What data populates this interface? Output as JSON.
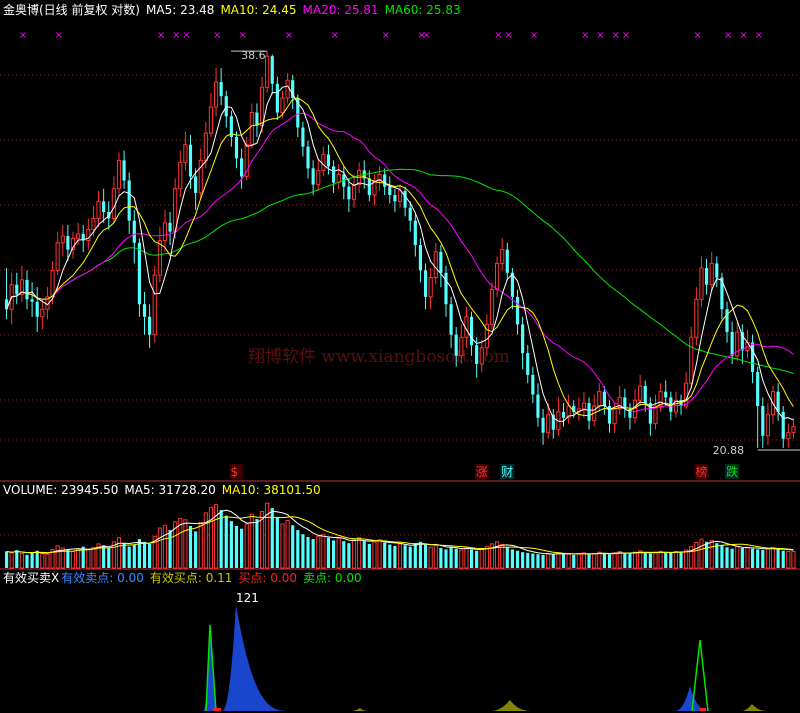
{
  "colors": {
    "bg": "#000000",
    "up": "#ff3232",
    "down": "#54ffff",
    "ma5": "#ffffff",
    "ma10": "#ffff00",
    "ma20": "#ff00ff",
    "ma60": "#00e600",
    "grid": "#c83232",
    "label": "#ffffff",
    "eff_buy": "#3c8cff",
    "eff_sell": "#c8c800",
    "buy": "#ff2020",
    "sell": "#00e600",
    "fill_blue": "#1a4ad8",
    "fill_olive": "#8c8c00"
  },
  "price_panel": {
    "title": "金奥博(日线 前复权 对数)",
    "ma5": {
      "label": "MA5:",
      "value": "23.48"
    },
    "ma10": {
      "label": "MA10:",
      "value": "24.45"
    },
    "ma20": {
      "label": "MA20:",
      "value": "25.81"
    },
    "ma60": {
      "label": "MA60:",
      "value": "25.83"
    },
    "high_label": "38.6",
    "low_label": "20.88",
    "watermark": "翔博软件 www.xiangbosoft.com",
    "event_markers": [
      {
        "text": "$",
        "color": "#ff3232"
      },
      {
        "text": "涨",
        "color": "#ff3232"
      },
      {
        "text": "财",
        "color": "#54ffff"
      },
      {
        "text": "榜",
        "color": "#ff3232"
      },
      {
        "text": "跌",
        "color": "#00e600"
      }
    ]
  },
  "volume_panel": {
    "volume": {
      "label": "VOLUME:",
      "value": "23945.50"
    },
    "ma5": {
      "label": "MA5:",
      "value": "31728.20"
    },
    "ma10": {
      "label": "MA10:",
      "value": "38101.50"
    }
  },
  "indicator_panel": {
    "name": "有效买卖X",
    "eff_buy": {
      "label": "有效卖点:",
      "value": "0.00"
    },
    "eff_sell": {
      "label": "有效买点:",
      "value": "0.11"
    },
    "sell": {
      "label": "买点:",
      "value": "0.00"
    },
    "buy": {
      "label": "卖点:",
      "value": "0.00"
    },
    "peak_label": "121"
  },
  "chart_data": {
    "type": "candlestick",
    "price_scale": "log",
    "ylim": [
      20.2,
      40.5
    ],
    "candles": [
      [
        26.3,
        25.9,
        27.6,
        25.5
      ],
      [
        25.9,
        26.9,
        27.4,
        25.3
      ],
      [
        26.9,
        26.5,
        27.4,
        26.1
      ],
      [
        26.5,
        27.1,
        27.7,
        26.2
      ],
      [
        27.1,
        26.3,
        27.5,
        25.9
      ],
      [
        26.3,
        26.2,
        27.0,
        25.6
      ],
      [
        26.2,
        25.6,
        26.8,
        25.0
      ],
      [
        25.6,
        25.9,
        26.3,
        25.1
      ],
      [
        25.9,
        26.4,
        26.8,
        25.5
      ],
      [
        26.4,
        27.5,
        27.9,
        26.1
      ],
      [
        27.5,
        28.7,
        29.2,
        27.3
      ],
      [
        28.7,
        29.0,
        29.5,
        28.1
      ],
      [
        29.0,
        28.4,
        29.5,
        27.9
      ],
      [
        28.4,
        28.9,
        29.2,
        28.0
      ],
      [
        28.9,
        29.1,
        29.6,
        28.6
      ],
      [
        29.1,
        28.8,
        29.5,
        28.3
      ],
      [
        28.8,
        29.3,
        29.8,
        28.4
      ],
      [
        29.3,
        29.8,
        30.4,
        29.0
      ],
      [
        29.8,
        30.6,
        31.1,
        29.4
      ],
      [
        30.6,
        30.1,
        31.2,
        29.6
      ],
      [
        30.1,
        29.8,
        30.6,
        29.3
      ],
      [
        29.8,
        31.2,
        31.8,
        29.6
      ],
      [
        31.2,
        32.6,
        33.0,
        30.9
      ],
      [
        32.6,
        31.6,
        33.1,
        31.2
      ],
      [
        31.6,
        29.7,
        32.0,
        29.1
      ],
      [
        29.7,
        28.7,
        30.2,
        27.8
      ],
      [
        28.7,
        26.1,
        28.9,
        25.6
      ],
      [
        26.1,
        25.6,
        26.6,
        24.9
      ],
      [
        25.6,
        24.9,
        26.1,
        24.4
      ],
      [
        24.9,
        27.3,
        27.7,
        24.6
      ],
      [
        27.3,
        28.8,
        29.4,
        27.0
      ],
      [
        28.8,
        29.6,
        30.2,
        28.3
      ],
      [
        29.6,
        29.2,
        30.1,
        28.6
      ],
      [
        29.2,
        31.2,
        31.7,
        28.9
      ],
      [
        31.2,
        32.5,
        33.1,
        30.8
      ],
      [
        32.5,
        33.4,
        34.1,
        32.1
      ],
      [
        33.4,
        31.8,
        33.9,
        31.2
      ],
      [
        31.8,
        31.0,
        32.2,
        30.2
      ],
      [
        31.0,
        32.6,
        33.2,
        30.7
      ],
      [
        32.6,
        34.0,
        34.6,
        32.2
      ],
      [
        34.0,
        35.4,
        36.2,
        33.8
      ],
      [
        35.4,
        36.8,
        37.6,
        34.9
      ],
      [
        36.8,
        36.0,
        37.6,
        35.5
      ],
      [
        36.0,
        34.9,
        36.3,
        34.3
      ],
      [
        34.9,
        33.8,
        35.2,
        33.3
      ],
      [
        33.8,
        32.7,
        34.1,
        32.2
      ],
      [
        32.7,
        31.8,
        33.2,
        31.2
      ],
      [
        31.8,
        33.4,
        33.8,
        31.6
      ],
      [
        33.4,
        35.1,
        35.6,
        33.2
      ],
      [
        35.1,
        34.4,
        35.6,
        33.8
      ],
      [
        34.4,
        36.5,
        37.1,
        34.0
      ],
      [
        36.5,
        38.3,
        38.6,
        36.2
      ],
      [
        38.3,
        36.7,
        38.4,
        36.1
      ],
      [
        36.7,
        35.1,
        37.1,
        34.7
      ],
      [
        35.1,
        35.9,
        36.3,
        34.8
      ],
      [
        35.9,
        36.9,
        37.3,
        35.6
      ],
      [
        36.9,
        35.9,
        37.2,
        35.3
      ],
      [
        35.9,
        34.3,
        36.1,
        33.8
      ],
      [
        34.3,
        33.3,
        34.6,
        32.8
      ],
      [
        33.3,
        32.2,
        33.6,
        31.7
      ],
      [
        32.2,
        31.4,
        32.6,
        30.9
      ],
      [
        31.4,
        32.1,
        32.7,
        31.1
      ],
      [
        32.1,
        32.9,
        33.3,
        31.8
      ],
      [
        32.9,
        32.3,
        33.4,
        31.9
      ],
      [
        32.3,
        31.5,
        32.6,
        31.0
      ],
      [
        31.5,
        31.9,
        32.4,
        31.2
      ],
      [
        31.9,
        31.3,
        32.3,
        30.7
      ],
      [
        31.3,
        30.7,
        31.7,
        30.1
      ],
      [
        30.7,
        31.4,
        31.9,
        30.3
      ],
      [
        31.4,
        32.1,
        32.5,
        31.0
      ],
      [
        32.1,
        31.7,
        32.6,
        31.2
      ],
      [
        31.7,
        30.9,
        32.1,
        30.6
      ],
      [
        30.9,
        31.6,
        31.9,
        30.4
      ],
      [
        31.6,
        31.9,
        32.3,
        31.1
      ],
      [
        31.9,
        31.3,
        32.2,
        30.9
      ],
      [
        31.3,
        30.9,
        31.8,
        30.5
      ],
      [
        30.9,
        30.6,
        31.2,
        30.1
      ],
      [
        30.6,
        31.1,
        31.4,
        30.3
      ],
      [
        31.1,
        30.3,
        31.3,
        29.9
      ],
      [
        30.3,
        29.7,
        30.6,
        29.2
      ],
      [
        29.7,
        28.6,
        30.0,
        28.1
      ],
      [
        28.6,
        27.5,
        28.9,
        27.0
      ],
      [
        27.5,
        26.4,
        27.8,
        25.9
      ],
      [
        26.4,
        27.2,
        27.6,
        25.9
      ],
      [
        27.2,
        28.3,
        28.7,
        26.9
      ],
      [
        28.3,
        27.4,
        28.6,
        26.8
      ],
      [
        27.4,
        26.1,
        27.7,
        25.6
      ],
      [
        26.1,
        24.9,
        26.4,
        24.4
      ],
      [
        24.9,
        24.1,
        25.2,
        23.7
      ],
      [
        24.1,
        24.8,
        25.3,
        23.8
      ],
      [
        24.8,
        25.6,
        26.0,
        24.4
      ],
      [
        25.6,
        24.5,
        25.8,
        24.1
      ],
      [
        24.5,
        23.8,
        24.8,
        23.3
      ],
      [
        23.8,
        24.4,
        24.7,
        23.5
      ],
      [
        24.4,
        25.3,
        25.7,
        24.1
      ],
      [
        25.3,
        26.7,
        27.0,
        25.1
      ],
      [
        26.7,
        27.8,
        28.1,
        26.4
      ],
      [
        27.8,
        28.4,
        28.9,
        27.5
      ],
      [
        28.4,
        27.4,
        28.7,
        27.1
      ],
      [
        27.4,
        26.4,
        27.6,
        25.9
      ],
      [
        26.4,
        25.3,
        26.7,
        24.9
      ],
      [
        25.3,
        24.2,
        25.6,
        23.6
      ],
      [
        24.2,
        23.4,
        24.5,
        23.1
      ],
      [
        23.4,
        22.7,
        23.7,
        22.4
      ],
      [
        22.7,
        21.9,
        23.1,
        21.6
      ],
      [
        21.9,
        21.4,
        22.2,
        21.0
      ],
      [
        21.4,
        22.0,
        22.4,
        21.2
      ],
      [
        22.0,
        21.5,
        22.2,
        21.2
      ],
      [
        21.5,
        22.1,
        22.6,
        21.3
      ],
      [
        22.1,
        21.9,
        22.4,
        21.6
      ],
      [
        21.9,
        22.3,
        22.7,
        21.7
      ],
      [
        22.3,
        22.1,
        22.5,
        21.9
      ],
      [
        22.1,
        22.2,
        22.6,
        21.8
      ],
      [
        22.2,
        22.4,
        22.8,
        21.9
      ],
      [
        22.4,
        21.8,
        22.6,
        21.5
      ],
      [
        21.8,
        22.3,
        22.7,
        21.6
      ],
      [
        22.3,
        22.8,
        23.1,
        22.1
      ],
      [
        22.8,
        22.3,
        23.0,
        22.0
      ],
      [
        22.3,
        21.7,
        22.5,
        21.4
      ],
      [
        21.7,
        22.2,
        22.4,
        21.4
      ],
      [
        22.2,
        22.6,
        23.0,
        22.0
      ],
      [
        22.6,
        22.2,
        22.9,
        21.9
      ],
      [
        22.2,
        21.9,
        22.4,
        21.5
      ],
      [
        21.9,
        22.5,
        22.9,
        21.7
      ],
      [
        22.5,
        23.0,
        23.4,
        22.3
      ],
      [
        23.0,
        22.4,
        23.2,
        22.1
      ],
      [
        22.4,
        21.7,
        22.6,
        21.3
      ],
      [
        21.7,
        22.3,
        22.7,
        21.5
      ],
      [
        22.3,
        22.8,
        23.1,
        22.1
      ],
      [
        22.8,
        22.6,
        23.2,
        22.3
      ],
      [
        22.6,
        22.1,
        22.8,
        21.8
      ],
      [
        22.1,
        22.5,
        22.8,
        21.9
      ],
      [
        22.5,
        22.3,
        22.7,
        22.0
      ],
      [
        22.3,
        23.1,
        23.5,
        22.2
      ],
      [
        23.1,
        24.8,
        25.2,
        22.9
      ],
      [
        24.8,
        26.3,
        26.8,
        24.5
      ],
      [
        26.3,
        27.6,
        28.1,
        26.0
      ],
      [
        27.6,
        26.9,
        28.0,
        26.5
      ],
      [
        26.9,
        27.8,
        28.3,
        26.6
      ],
      [
        27.8,
        27.2,
        28.1,
        26.8
      ],
      [
        27.2,
        25.9,
        27.4,
        25.5
      ],
      [
        25.9,
        25.0,
        26.2,
        24.6
      ],
      [
        25.0,
        24.1,
        25.4,
        23.8
      ],
      [
        24.1,
        25.0,
        25.4,
        23.9
      ],
      [
        25.0,
        24.3,
        25.3,
        23.8
      ],
      [
        24.3,
        24.6,
        25.1,
        24.0
      ],
      [
        24.6,
        23.5,
        24.9,
        23.1
      ],
      [
        23.5,
        22.3,
        23.7,
        20.9
      ],
      [
        22.3,
        21.3,
        22.6,
        20.9
      ],
      [
        21.3,
        22.0,
        22.4,
        21.0
      ],
      [
        22.0,
        22.8,
        23.0,
        21.7
      ],
      [
        22.8,
        22.1,
        23.1,
        21.8
      ],
      [
        22.1,
        21.2,
        22.3,
        20.9
      ],
      [
        21.2,
        21.4,
        21.7,
        20.9
      ],
      [
        21.4,
        21.6,
        21.9,
        21.2
      ]
    ],
    "volume": [
      24000,
      22000,
      26000,
      21000,
      19000,
      23000,
      25000,
      21000,
      20000,
      27000,
      32000,
      29000,
      26000,
      24000,
      28000,
      31000,
      27000,
      30000,
      35000,
      33000,
      29000,
      38000,
      44000,
      36000,
      31000,
      34000,
      42000,
      38000,
      35000,
      46000,
      58000,
      62000,
      55000,
      67000,
      72000,
      70000,
      61000,
      53000,
      66000,
      80000,
      88000,
      92000,
      84000,
      76000,
      68000,
      61000,
      57000,
      64000,
      78000,
      71000,
      82000,
      94000,
      87000,
      73000,
      64000,
      69000,
      62000,
      55000,
      49000,
      45000,
      42000,
      46000,
      49000,
      44000,
      40000,
      43000,
      39000,
      36000,
      41000,
      44000,
      39000,
      35000,
      38000,
      41000,
      37000,
      34000,
      32000,
      35000,
      33000,
      31000,
      36000,
      38000,
      34000,
      30000,
      33000,
      29000,
      27000,
      31000,
      28000,
      26000,
      29000,
      27000,
      25000,
      28000,
      31000,
      35000,
      38000,
      34000,
      30000,
      27000,
      25000,
      23000,
      22000,
      21000,
      20000,
      19000,
      21000,
      20000,
      22000,
      21000,
      20000,
      19000,
      21000,
      22000,
      20000,
      21000,
      23000,
      21000,
      20000,
      22000,
      24000,
      22000,
      21000,
      23000,
      25000,
      23000,
      21000,
      22000,
      24000,
      23000,
      22000,
      24000,
      23000,
      26000,
      31000,
      37000,
      42000,
      38000,
      40000,
      36000,
      33000,
      30000,
      28000,
      31000,
      29000,
      30000,
      28000,
      27000,
      26000,
      28000,
      30000,
      27000,
      25000,
      24000,
      23945
    ]
  }
}
